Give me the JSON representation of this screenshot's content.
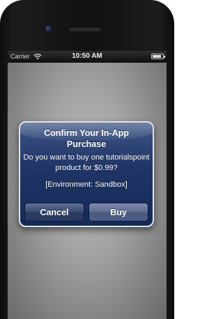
{
  "status_bar": {
    "carrier": "Carrier",
    "time": "10:50 AM",
    "battery_level": 0.85
  },
  "alert": {
    "title": "Confirm Your In-App Purchase",
    "message": "Do you want to buy one tutorialspoint product for $0.99?",
    "environment": "[Environment: Sandbox]",
    "cancel_label": "Cancel",
    "buy_label": "Buy"
  },
  "icons": {
    "wifi": "wifi-icon",
    "battery": "battery-icon",
    "camera": "camera-icon"
  }
}
